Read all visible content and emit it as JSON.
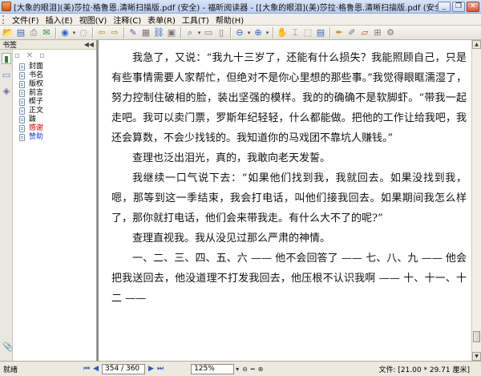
{
  "window": {
    "title": "[大象的眼泪](美)莎拉·格鲁恩.清晰扫描版.pdf (安全) - 福昕阅读器 - [[大象的眼泪](美)莎拉·格鲁恩.清晰扫描版.pdf (安全)]",
    "minimize_icon": "minimize-icon",
    "restore_icon": "restore-icon",
    "close_icon": "close-icon"
  },
  "menu": {
    "items": [
      "文件(F)",
      "插入(E)",
      "视图(V)",
      "注释(C)",
      "表单(R)",
      "工具(T)",
      "帮助(H)"
    ]
  },
  "toolbar": {
    "icons": [
      "open-icon",
      "save-icon",
      "print-icon",
      "email-icon",
      "back-icon",
      "forward-icon",
      "folder-icon",
      "copy-icon",
      "typewriter-icon",
      "paste-icon",
      "link-icon",
      "camera-icon",
      "search-icon",
      "zoom-in-icon",
      "zoom-out-icon",
      "fit-page-icon",
      "hand-tool-icon",
      "text-select-icon",
      "note-icon",
      "highlight-icon",
      "pencil-icon",
      "shape-icon"
    ]
  },
  "sidebar": {
    "title": "书签",
    "bookmarks": [
      {
        "label": "封面",
        "color": "#000000"
      },
      {
        "label": "书名",
        "color": "#000000"
      },
      {
        "label": "版权",
        "color": "#000000"
      },
      {
        "label": "前言",
        "color": "#000000"
      },
      {
        "label": "楔子",
        "color": "#000000"
      },
      {
        "label": "正文",
        "color": "#000000"
      },
      {
        "label": "跋",
        "color": "#000000"
      },
      {
        "label": "感谢",
        "color": "#d40000"
      },
      {
        "label": "赞助",
        "color": "#1a3cd8"
      }
    ]
  },
  "document": {
    "paragraphs": [
      "我急了，又说：“我九十三岁了，还能有什么损失？我能照顾自己，只是有些事情需要人家帮忙，但绝对不是你心里想的那些事。”我觉得眼眶濡湿了，努力控制住破相的脸，装出坚强的模样。我的的确确不是软脚虾。“带我一起走吧。我可以卖门票，罗斯年纪轻轻，什么都能做。把他的工作让给我吧，我还会算数，不会少找钱的。我知道你的马戏团不靠坑人赚钱。”",
      "查理也泛出泪光，真的，我敢向老天发誓。",
      "我继续一口气说下去：“如果他们找到我，我就回去。如果没找到我，嗯，那等到这一季结束，我会打电话，叫他们接我回去。如果期间我怎么样了，那你就打电话，他们会来带我走。有什么大不了的呢?”",
      "查理直视我。我从没见过那么严肃的神情。",
      "一、二、三、四、五、六 —— 他不会回答了 —— 七、八、九 —— 他会把我送回去，他没道理不打发我回去，他压根不认识我啊 —— 十、十一、十二 ——"
    ]
  },
  "status": {
    "state": "就绪",
    "page": "354 / 360",
    "zoom": "125%",
    "page_size": "文件: [21.00 * 29.71 厘米]"
  }
}
